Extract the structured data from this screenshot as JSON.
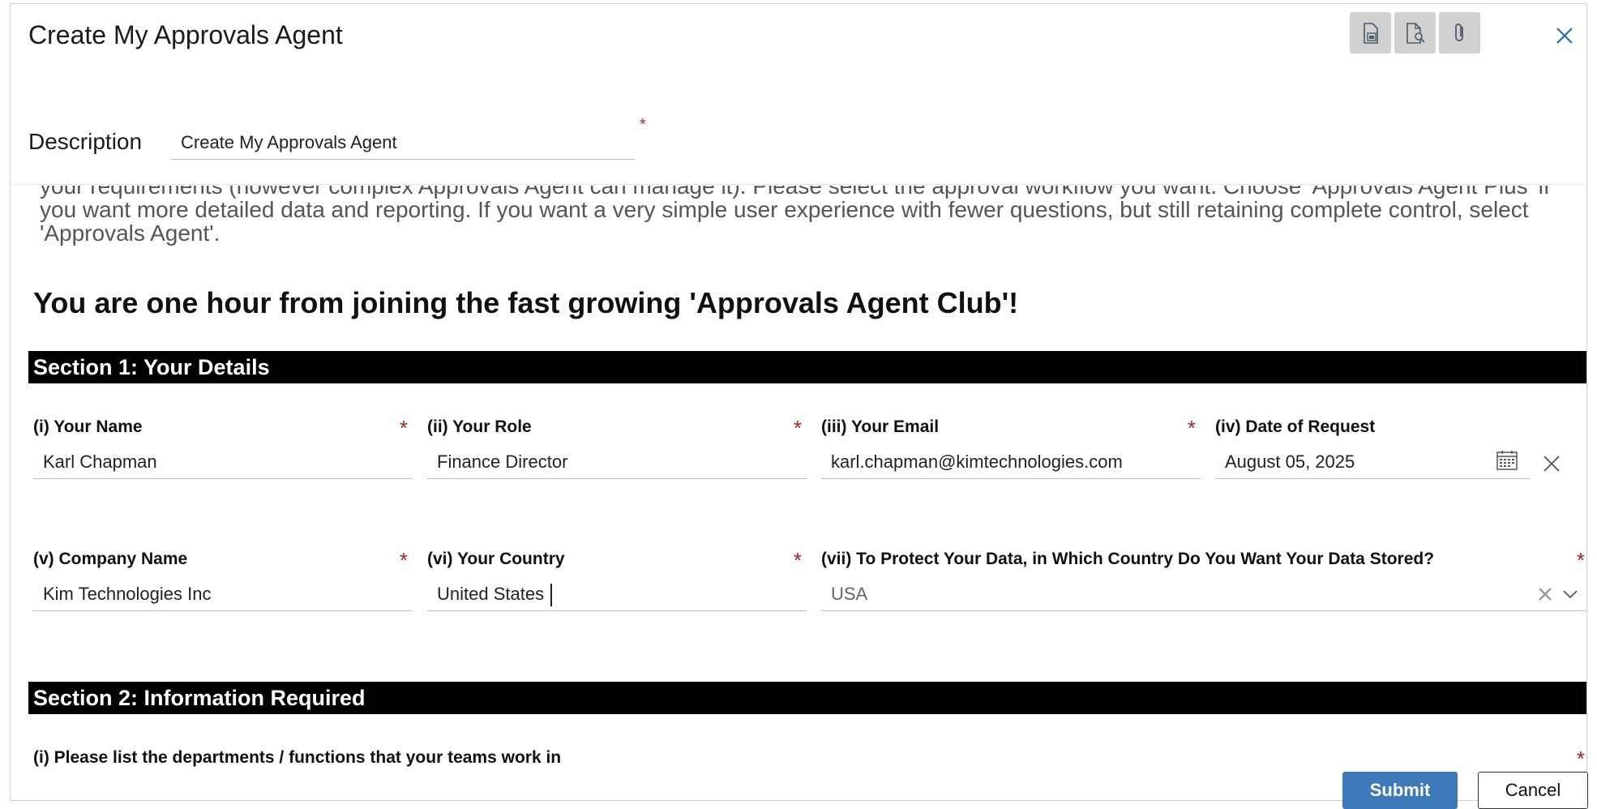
{
  "dialog": {
    "title": "Create My Approvals Agent",
    "toolbar": [
      {
        "icon": "save-icon"
      },
      {
        "icon": "document-search-icon"
      },
      {
        "icon": "attachment-icon"
      }
    ],
    "close_icon": "close-icon"
  },
  "description": {
    "label": "Description",
    "value": "Create My Approvals Agent",
    "required_mark": "*"
  },
  "intro": {
    "text": "your requirements (however complex Approvals Agent can manage it). Please select the approval workflow you want. Choose 'Approvals Agent Plus' if you want more detailed data and reporting. If you want a very simple user experience with fewer questions, but still retaining complete control, select 'Approvals Agent'.",
    "headline": "You are one hour from joining the fast growing 'Approvals Agent Club'!"
  },
  "section1": {
    "title": "Section 1: Your Details",
    "fields": {
      "name": {
        "label": "(i) Your Name",
        "value": "Karl Chapman",
        "required": "*"
      },
      "role": {
        "label": "(ii) Your Role",
        "value": "Finance Director",
        "required": "*"
      },
      "email": {
        "label": "(iii) Your Email",
        "value": "karl.chapman@kimtechnologies.com",
        "required": "*"
      },
      "date": {
        "label": "(iv) Date of Request",
        "value": "August 05, 2025"
      },
      "company": {
        "label": "(v) Company Name",
        "value": "Kim Technologies Inc",
        "required": "*"
      },
      "country": {
        "label": "(vi) Your Country",
        "value": "United States",
        "required": "*"
      },
      "data_country": {
        "label": "(vii) To Protect Your Data, in Which Country Do You Want Your Data Stored?",
        "value": "USA",
        "required": "*"
      }
    }
  },
  "section2": {
    "title": "Section 2: Information Required",
    "departments": {
      "label": "(i) Please list the departments / functions that your teams work in",
      "required": "*"
    }
  },
  "footer": {
    "submit_label": "Submit",
    "cancel_label": "Cancel"
  },
  "colors": {
    "required": "#a4262c",
    "submit": "#3d79b9",
    "section_bar": "#000000"
  }
}
